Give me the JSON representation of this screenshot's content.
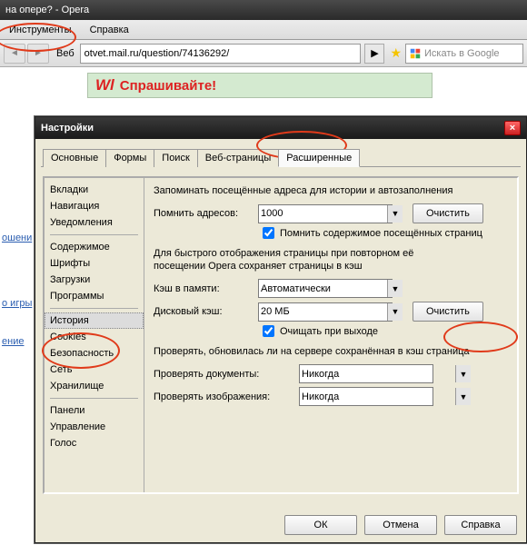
{
  "window": {
    "title": "на опере? - Opera"
  },
  "menu": {
    "tools": "Инструменты",
    "help": "Справка"
  },
  "addr": {
    "label": "Веб",
    "url": "otvet.mail.ru/question/74136292/"
  },
  "search": {
    "placeholder": "Искать в Google"
  },
  "banner": {
    "logo": "Wl",
    "text": "Спрашивайте!"
  },
  "sidelinks": {
    "a": "ошени",
    "b": "",
    "c": "о игры",
    "d": "",
    "e": "ение"
  },
  "dialog": {
    "title": "Настройки",
    "tabs": {
      "basic": "Основные",
      "forms": "Формы",
      "search": "Поиск",
      "webpages": "Веб-страницы",
      "advanced": "Расширенные"
    },
    "side": {
      "tabs": "Вкладки",
      "nav": "Навигация",
      "notif": "Уведомления",
      "content": "Содержимое",
      "fonts": "Шрифты",
      "downloads": "Загрузки",
      "programs": "Программы",
      "history": "История",
      "cookies": "Cookies",
      "security": "Безопасность",
      "network": "Сеть",
      "storage": "Хранилище",
      "panels": "Панели",
      "manage": "Управление",
      "voice": "Голос"
    },
    "panel": {
      "remember_text": "Запоминать посещённые адреса для истории и автозаполнения",
      "remember_addr_label": "Помнить адресов:",
      "remember_addr_value": "1000",
      "clear_btn": "Очистить",
      "remember_content_cb": "Помнить содержимое посещённых страниц",
      "cache_desc1": "Для быстрого отображения страницы при повторном её",
      "cache_desc2": "посещении Opera сохраняет страницы в кэш",
      "mem_cache_label": "Кэш в памяти:",
      "mem_cache_value": "Автоматически",
      "disk_cache_label": "Дисковый кэш:",
      "disk_cache_value": "20 МБ",
      "clear_on_exit_cb": "Очищать при выходе",
      "check_desc": "Проверять, обновилась ли на сервере сохранённая в кэш страница",
      "check_docs_label": "Проверять документы:",
      "check_docs_value": "Никогда",
      "check_imgs_label": "Проверять изображения:",
      "check_imgs_value": "Никогда"
    },
    "buttons": {
      "ok": "ОК",
      "cancel": "Отмена",
      "help": "Справка"
    }
  }
}
